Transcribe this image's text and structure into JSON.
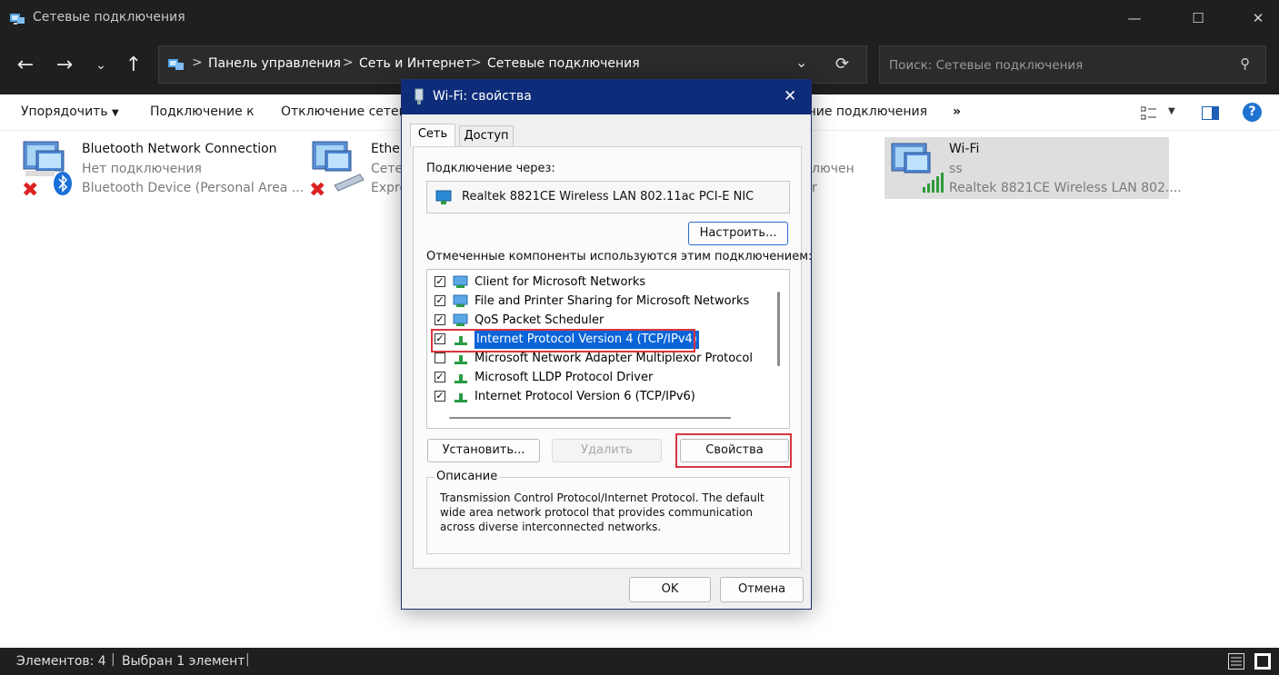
{
  "window": {
    "title": "Сетевые подключения",
    "minimize": "—",
    "maximize": "☐",
    "close": "✕"
  },
  "address": {
    "crumbs": [
      "Панель управления",
      "Сеть и Интернет",
      "Сетевые подключения"
    ],
    "separator": ">"
  },
  "search": {
    "placeholder": "Поиск: Сетевые подключения"
  },
  "toolbar": {
    "organize": "Упорядочить",
    "connect": "Подключение к",
    "disconnect": "Отключение сетево",
    "status": "ание подключения",
    "more": "»"
  },
  "connections": [
    {
      "name": "Bluetooth Network Connection",
      "status": "Нет подключения",
      "device": "Bluetooth Device (Personal Area ..."
    },
    {
      "name": "Ether",
      "status": "Сете",
      "device": "Expre"
    },
    {
      "name": "",
      "status": "лючен",
      "device": "r"
    },
    {
      "name": "Wi-Fi",
      "status": "ss",
      "device": "Realtek 8821CE Wireless LAN 802...."
    }
  ],
  "statusbar": {
    "count": "Элементов: 4",
    "selected": "Выбран 1 элемент"
  },
  "dialog": {
    "title": "Wi-Fi: свойства",
    "tabs": [
      "Сеть",
      "Доступ"
    ],
    "connect_using_label": "Подключение через:",
    "adapter": "Realtek 8821CE Wireless LAN 802.11ac PCI-E NIC",
    "configure_btn": "Настроить...",
    "components_label": "Отмеченные компоненты используются этим подключением:",
    "components": [
      {
        "label": "Client for Microsoft Networks",
        "checked": true,
        "icon": "network-client-icon"
      },
      {
        "label": "File and Printer Sharing for Microsoft Networks",
        "checked": true,
        "icon": "network-service-icon"
      },
      {
        "label": "QoS Packet Scheduler",
        "checked": true,
        "icon": "network-service-icon"
      },
      {
        "label": "Internet Protocol Version 4 (TCP/IPv4)",
        "checked": true,
        "icon": "protocol-icon",
        "selected": true
      },
      {
        "label": "Microsoft Network Adapter Multiplexor Protocol",
        "checked": false,
        "icon": "protocol-icon"
      },
      {
        "label": "Microsoft LLDP Protocol Driver",
        "checked": true,
        "icon": "protocol-icon"
      },
      {
        "label": "Internet Protocol Version 6 (TCP/IPv6)",
        "checked": true,
        "icon": "protocol-icon"
      }
    ],
    "install_btn": "Установить...",
    "remove_btn": "Удалить",
    "properties_btn": "Свойства",
    "description_label": "Описание",
    "description": "Transmission Control Protocol/Internet Protocol. The default wide area network protocol that provides communication across diverse interconnected networks.",
    "ok_btn": "OK",
    "cancel_btn": "Отмена"
  },
  "colors": {
    "dialog_title_bar": "#0d2c7a",
    "highlight": "#0a64d8",
    "annotation_red": "#d9353f",
    "explorer_dark": "#1f1f1f"
  }
}
